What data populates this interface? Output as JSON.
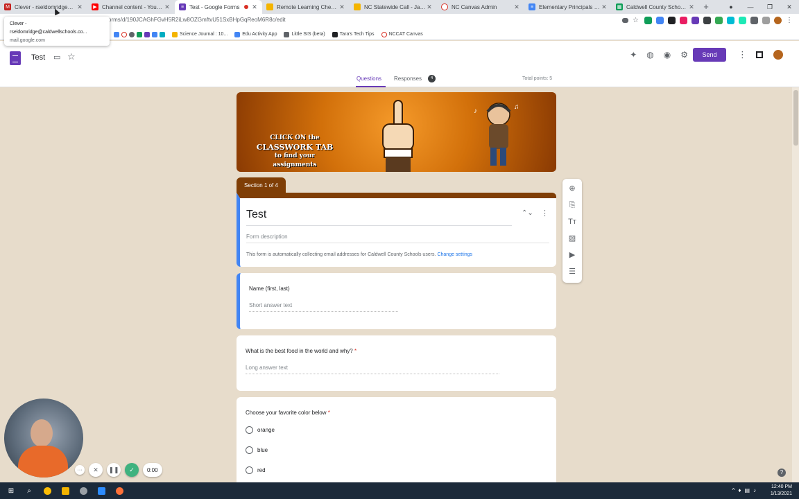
{
  "browser": {
    "tabs": [
      {
        "title": "Clever - rseldomridge@calc",
        "fav_color": "#c5221f",
        "fav_glyph": "M",
        "active": false,
        "recording": false
      },
      {
        "title": "Channel content - YouTube",
        "fav_color": "#ff0000",
        "fav_glyph": "▶",
        "active": false,
        "recording": false
      },
      {
        "title": "Test - Google Forms",
        "fav_color": "#673ab7",
        "fav_glyph": "≡",
        "active": true,
        "recording": true
      },
      {
        "title": "Remote Learning Checklist",
        "fav_color": "#f4b400",
        "fav_glyph": "■",
        "active": false,
        "recording": false
      },
      {
        "title": "NC Statewide Call - January",
        "fav_color": "#f4b400",
        "fav_glyph": "■",
        "active": false,
        "recording": false
      },
      {
        "title": "NC Canvas Admin",
        "fav_color": "#d93025",
        "fav_glyph": "○",
        "active": false,
        "recording": false
      },
      {
        "title": "Elementary Principals Work",
        "fav_color": "#4285f4",
        "fav_glyph": "≡",
        "active": false,
        "recording": false
      },
      {
        "title": "Caldwell County Schools -",
        "fav_color": "#0f9d58",
        "fav_glyph": "▦",
        "active": false,
        "recording": false
      }
    ],
    "new_tab": "+",
    "url": "orms/d/190JCAGhFGvH5R2iLw8OZGmftvU51SxBHpGqReoM6R8c/edit",
    "bookmarks": [
      {
        "label": "Science Journal : 10...",
        "color": "#f4b400"
      },
      {
        "label": "Edu Activity App",
        "color": "#4285f4"
      },
      {
        "label": "Little SIS (beta)",
        "color": "#5f6368"
      },
      {
        "label": "Tara's Tech Tips",
        "color": "#202124"
      },
      {
        "label": "NCCAT Canvas",
        "color": "#d93025"
      }
    ],
    "tooltip": {
      "title": "Clever -",
      "email": "rseldomridge@caldwellschools.co...",
      "domain": "mail.google.com"
    }
  },
  "forms_header": {
    "doc_title": "Test",
    "send_label": "Send",
    "tabs": {
      "questions": "Questions",
      "responses": "Responses",
      "responses_count": "4"
    },
    "total_points": "Total points: 5"
  },
  "banner": {
    "line1": "CLICK ON the",
    "line2": "CLASSWORK TAB",
    "line3": "to find your",
    "line4": "assignments"
  },
  "section_label": "Section 1 of 4",
  "title_card": {
    "title": "Test",
    "description_placeholder": "Form description",
    "email_note": "This form is automatically collecting email addresses for Caldwell County Schools users.",
    "change_settings": "Change settings"
  },
  "questions": [
    {
      "title": "Name (first, last)",
      "required": false,
      "hint": "Short answer text"
    },
    {
      "title": "What is the best food in the world and why?",
      "required": true,
      "hint": "Long answer text"
    },
    {
      "title": "Choose your favorite color below",
      "required": true,
      "options": [
        "orange",
        "blue",
        "red"
      ]
    }
  ],
  "required_mark": "*",
  "recorder": {
    "time": "0:00"
  },
  "taskbar": {
    "time": "12:40 PM",
    "date": "1/13/2021"
  },
  "colors": {
    "forms_purple": "#673ab7",
    "section_brown": "#7f3e06",
    "page_bg": "#e7dccb",
    "selected_blue": "#4285f4"
  }
}
